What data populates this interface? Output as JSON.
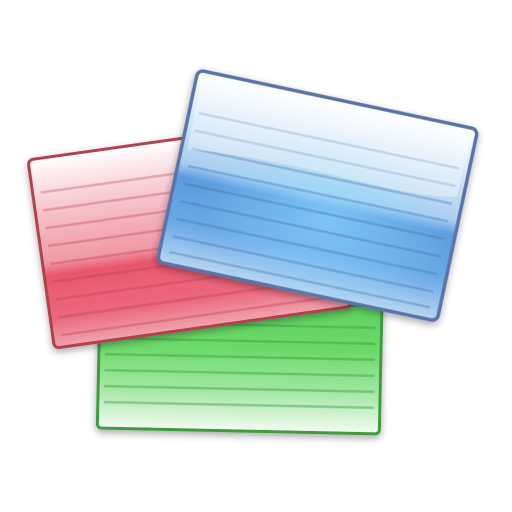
{
  "icon": {
    "name": "index-cards-icon",
    "cards": [
      {
        "id": "green",
        "color": "#5fcf5f",
        "edge": "#3f9a3f"
      },
      {
        "id": "red",
        "color": "#e65a6e",
        "edge": "#b24050"
      },
      {
        "id": "blue",
        "color": "#5c9be0",
        "edge": "#5b73a6"
      }
    ]
  }
}
